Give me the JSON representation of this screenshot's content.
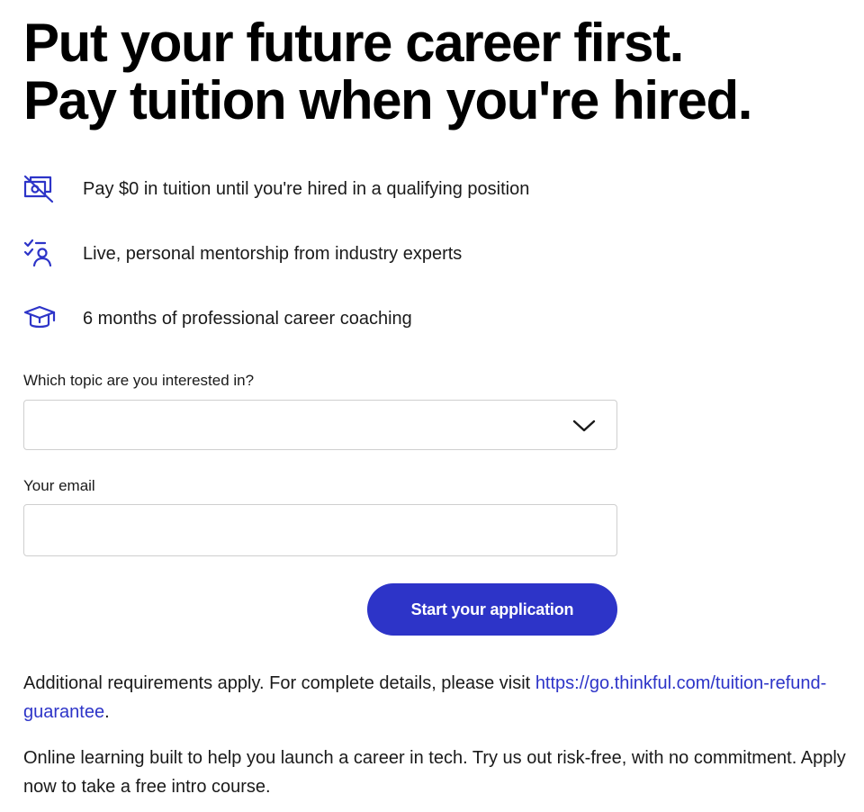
{
  "headline": {
    "line1": "Put your future career first.",
    "line2": "Pay tuition when you're hired."
  },
  "features": [
    {
      "icon": "no-payment-icon",
      "text": "Pay $0 in tuition until you're hired in a qualifying position"
    },
    {
      "icon": "mentor-checklist-icon",
      "text": "Live, personal mentorship from industry experts"
    },
    {
      "icon": "graduation-cap-icon",
      "text": "6 months of professional career coaching"
    }
  ],
  "form": {
    "topic_label": "Which topic are you interested in?",
    "topic_value": "",
    "email_label": "Your email",
    "email_value": "",
    "email_placeholder": "",
    "submit_label": "Start your application"
  },
  "disclaimer": {
    "text": "Additional requirements apply. For complete details, please visit ",
    "link_text": "https://go.thinkful.com/tuition-refund-guarantee",
    "after_link": "."
  },
  "intro": {
    "text": "Online learning built to help you launch a career in tech. Try us out risk-free, with no commitment. Apply now to take a free intro course."
  },
  "colors": {
    "accent": "#2d34c8",
    "text": "#1a1a1a",
    "border": "#cfcfcf"
  }
}
